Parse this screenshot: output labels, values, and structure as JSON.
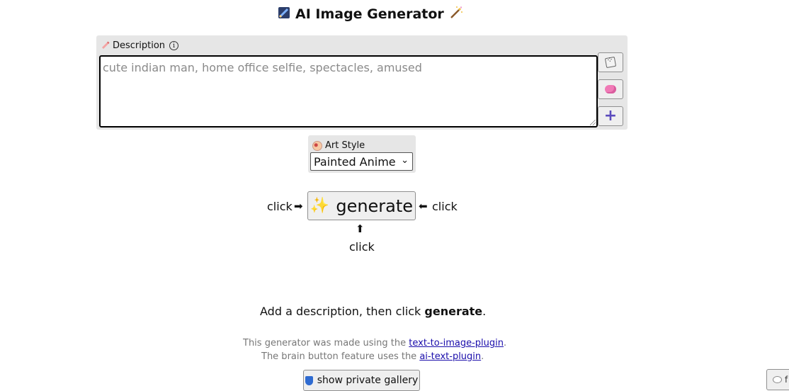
{
  "header": {
    "title": "AI Image Generator",
    "left_icon": "paint-brush-icon",
    "right_icon": "magic-wand-icon"
  },
  "description": {
    "label": "Description",
    "info_icon": "info-icon",
    "placeholder": "cute indian man, home office selfie, spectacles, amused",
    "buttons": [
      {
        "icon": "dice-icon"
      },
      {
        "icon": "brain-icon"
      },
      {
        "icon": "plus-icon",
        "label": "+"
      }
    ]
  },
  "art_style": {
    "label": "Art Style",
    "selected": "Painted Anime",
    "chevron": "⌄"
  },
  "generate": {
    "label": "generate",
    "icon": "sparkles-icon",
    "sparkle_glyph": "✨"
  },
  "click_hints": {
    "left": "click",
    "right": "click",
    "below": "click",
    "arrow_right": "➡",
    "arrow_left": "⬅",
    "arrow_up": "⬆"
  },
  "instruction": {
    "prefix": "Add a description, then click ",
    "bold": "generate",
    "suffix": "."
  },
  "credits": {
    "line1_prefix": "This generator was made using the ",
    "line1_link": "text-to-image-plugin",
    "line2_prefix": "The brain button feature uses the ",
    "line2_link": "ai-text-plugin",
    "period": "."
  },
  "gallery": {
    "label": "show private gallery",
    "icon": "shield-icon"
  },
  "corner_button": {
    "icon": "chat-bubble-icon",
    "label": "f"
  },
  "colors": {
    "panel_bg": "#e6e6e6",
    "button_bg": "#efefef",
    "link": "#1a0dab",
    "plus": "#5b4bbd"
  }
}
